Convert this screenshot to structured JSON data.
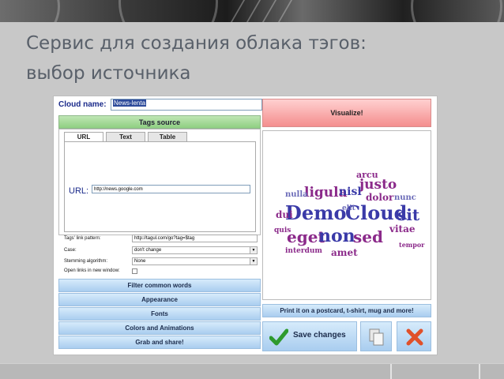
{
  "slide": {
    "title_line1": "Сервис для создания облака тэгов:",
    "title_line2": "выбор источника"
  },
  "cloud_name": {
    "label": "Cloud name:",
    "value": "News-lenta"
  },
  "tags_source": {
    "header": "Tags source",
    "tabs": [
      {
        "label": "URL"
      },
      {
        "label": "Text"
      },
      {
        "label": "Table"
      }
    ],
    "url_label": "URL:",
    "url_value": "http://news.google.com"
  },
  "options": {
    "link_pattern_label": "Tags' link pattern:",
    "link_pattern_value": "http://tagul.com/go?tag=$tag",
    "case_label": "Case:",
    "case_value": "don't change",
    "stemming_label": "Stemming algorithm:",
    "stemming_value": "None",
    "open_links_label": "Open links in new window:"
  },
  "sections": [
    {
      "label": "Filter common words"
    },
    {
      "label": "Appearance"
    },
    {
      "label": "Fonts"
    },
    {
      "label": "Colors and Animations"
    },
    {
      "label": "Grab and share!"
    }
  ],
  "right": {
    "visualize": "Visualize!",
    "print": "Print it on a postcard, t-shirt, mug and more!",
    "save": "Save changes"
  },
  "word_cloud": {
    "words": [
      "Demo",
      "Cloud",
      "sit",
      "eget",
      "non",
      "sed",
      "ligula",
      "justo",
      "nisl",
      "dolor",
      "elit",
      "amet",
      "vitae",
      "interdum",
      "nulla",
      "arcu",
      "nunc",
      "tempor",
      "dui",
      "quis"
    ],
    "colors": {
      "primary": "#3a3aa8",
      "secondary": "#8b2a8a",
      "tertiary": "#6b6bb8"
    }
  },
  "icons": {
    "save": "checkmark-icon",
    "copy": "copy-icon",
    "delete": "delete-x-icon"
  }
}
